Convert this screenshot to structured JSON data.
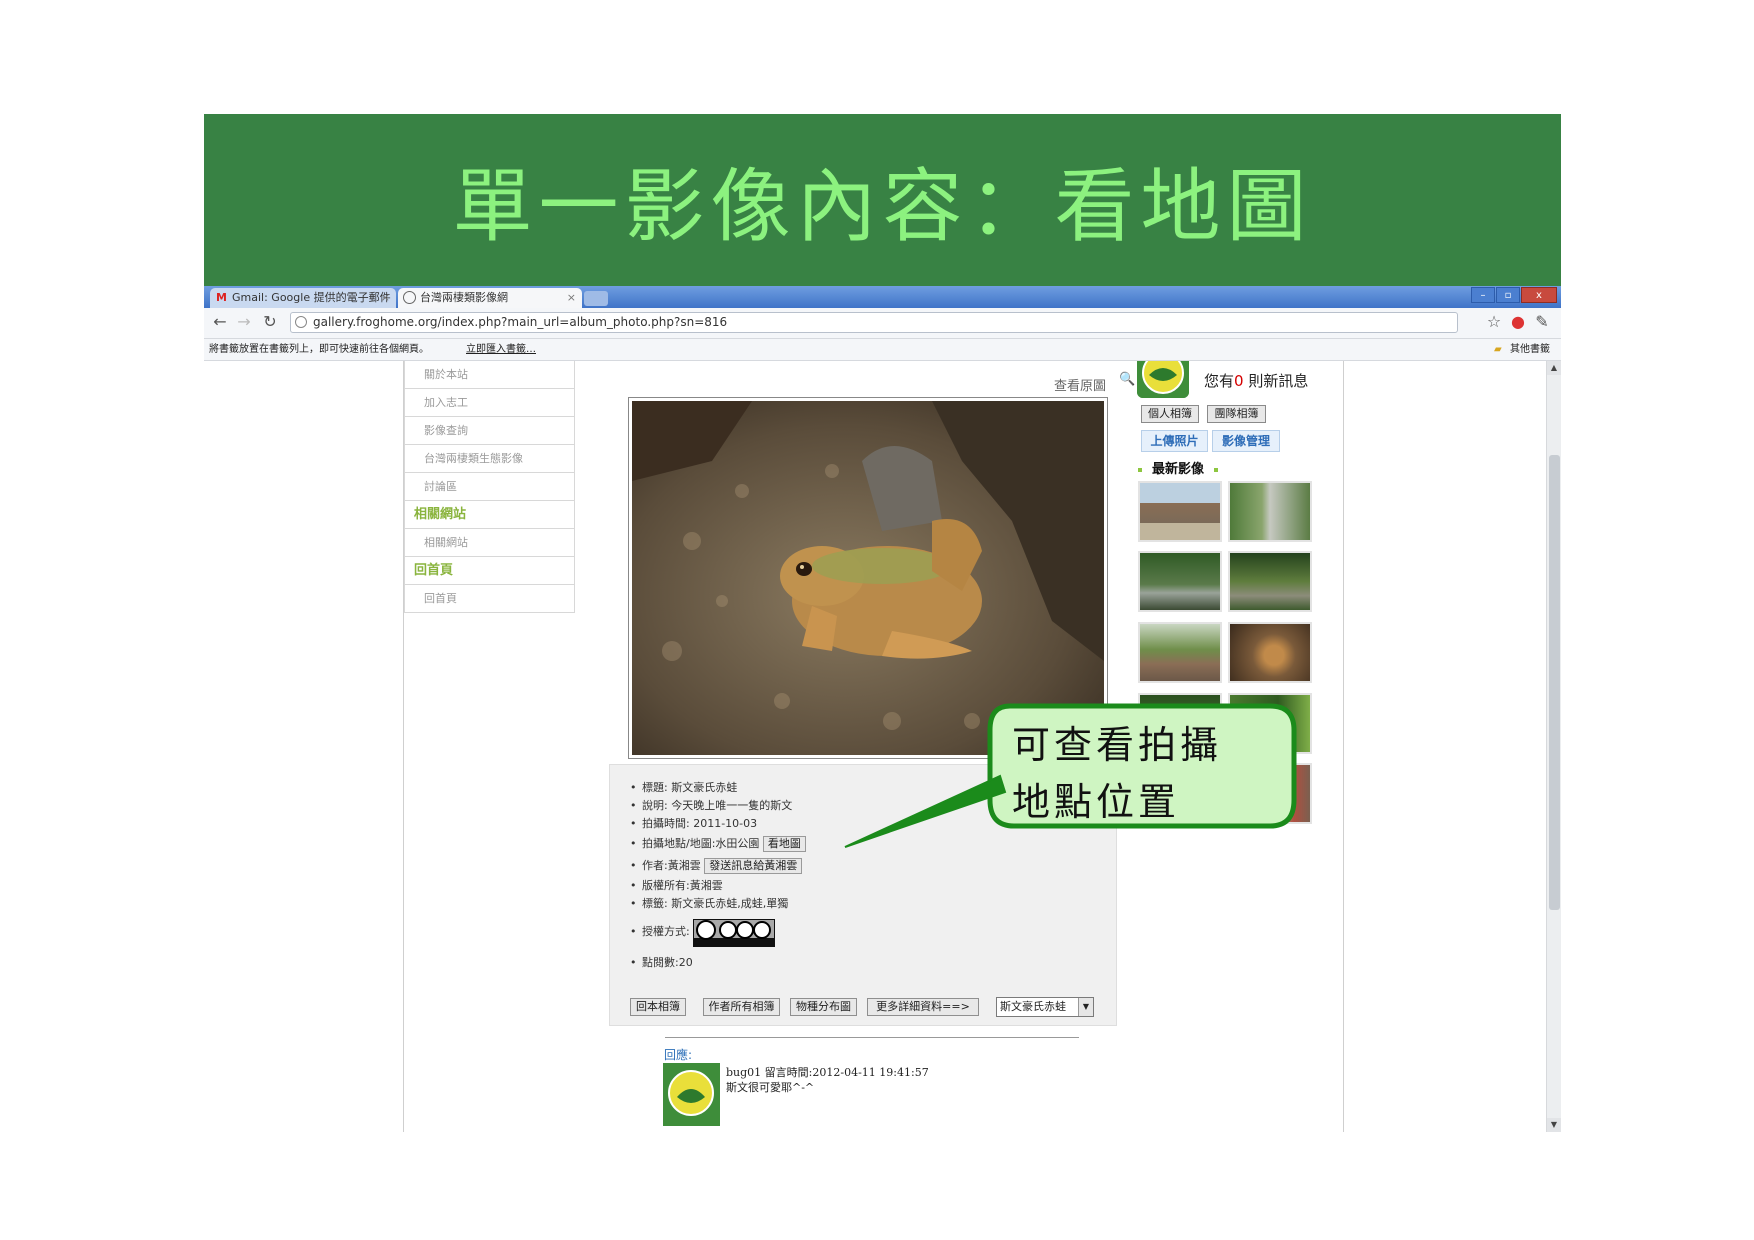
{
  "slide": {
    "title": "單一影像內容：看地圖"
  },
  "browser": {
    "tabs": [
      {
        "icon": "gmail-icon",
        "label": "Gmail: Google 提供的電子郵件"
      },
      {
        "icon": "globe-icon",
        "label": "台灣兩棲類影像網"
      }
    ],
    "url": "gallery.froghome.org/index.php?main_url=album_photo.php?sn=816",
    "bookmark_prompt": "將書籤放置在書籤列上，即可快速前往各個網頁。",
    "bookmark_link": "立即匯入書籤…",
    "other_bookmarks": "其他書籤",
    "window_buttons": [
      "–",
      "▫",
      "x"
    ]
  },
  "left_menu": [
    {
      "label": "關於本站",
      "type": "item"
    },
    {
      "label": "加入志工",
      "type": "item"
    },
    {
      "label": "影像查詢",
      "type": "item"
    },
    {
      "label": "台灣兩棲類生態影像",
      "type": "item"
    },
    {
      "label": "討論區",
      "type": "item"
    },
    {
      "label": "相關網站",
      "type": "head"
    },
    {
      "label": "相關網站",
      "type": "item"
    },
    {
      "label": "回首頁",
      "type": "head"
    },
    {
      "label": "回首頁",
      "type": "item"
    }
  ],
  "photo": {
    "view_original": "查看原圖"
  },
  "info": {
    "title": "標題: 斯文豪氏赤蛙",
    "description": "說明: 今天晚上唯一一隻的斯文",
    "date": "拍攝時間: 2011-10-03",
    "location": "拍攝地點/地圖:水田公園",
    "map_button": "看地圖",
    "author": "作者:黃湘雲",
    "message_button": "發送訊息給黃湘雲",
    "copyright": "版權所有:黃湘雲",
    "tags": "標籤: 斯文豪氏赤蛙,成蛙,單獨",
    "license": "授權方式:",
    "views": "點閱數:20",
    "bottom_buttons": [
      "回本相簿",
      "作者所有相簿",
      "物種分布圖",
      "更多詳細資料==>"
    ],
    "species_select": "斯文豪氏赤蛙"
  },
  "comments": {
    "label": "回應:",
    "meta": "bug01 留言時間:2012-04-11 19:41:57",
    "body": "斯文很可愛耶^-^"
  },
  "right": {
    "new_msg_prefix": "您有",
    "new_msg_count": "0",
    "new_msg_suffix": "則新訊息",
    "buttons": [
      "個人相簿",
      "團隊相簿"
    ],
    "buttons2": [
      "上傳照片",
      "影像管理"
    ],
    "latest_title": "最新影像"
  },
  "callout": {
    "line1": "可查看拍攝",
    "line2": "地點位置"
  }
}
